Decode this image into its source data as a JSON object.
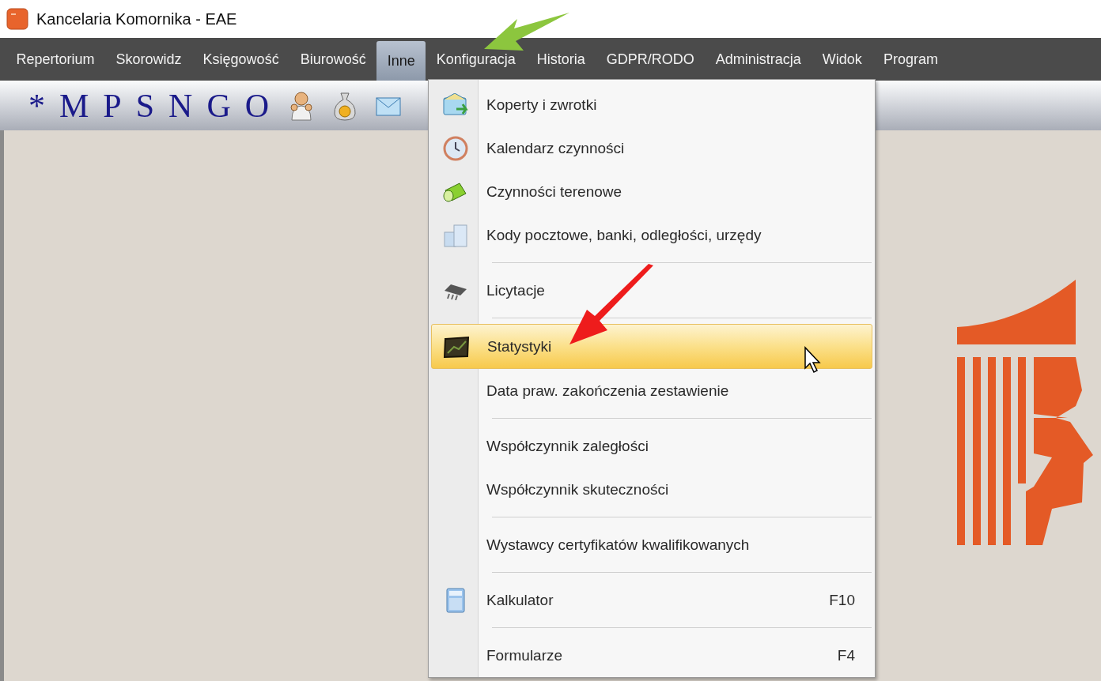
{
  "window": {
    "title": "Kancelaria Komornika - EAE"
  },
  "menubar": [
    {
      "label": "Repertorium",
      "selected": false
    },
    {
      "label": "Skorowidz",
      "selected": false
    },
    {
      "label": "Księgowość",
      "selected": false
    },
    {
      "label": "Biurowość",
      "selected": false
    },
    {
      "label": "Inne",
      "selected": true
    },
    {
      "label": "Konfiguracja",
      "selected": false
    },
    {
      "label": "Historia",
      "selected": false
    },
    {
      "label": "GDPR/RODO",
      "selected": false
    },
    {
      "label": "Administracja",
      "selected": false
    },
    {
      "label": "Widok",
      "selected": false
    },
    {
      "label": "Program",
      "selected": false
    }
  ],
  "toolbar": [
    {
      "kind": "text",
      "label": "*"
    },
    {
      "kind": "text",
      "label": "M"
    },
    {
      "kind": "text",
      "label": "P"
    },
    {
      "kind": "text",
      "label": "S"
    },
    {
      "kind": "text",
      "label": "N"
    },
    {
      "kind": "text",
      "label": "G"
    },
    {
      "kind": "text",
      "label": "O"
    },
    {
      "kind": "person"
    },
    {
      "kind": "moneybag"
    },
    {
      "kind": "envelope"
    }
  ],
  "menu": [
    {
      "kind": "envelope",
      "label": "Koperty i zwrotki",
      "separator_before": false,
      "selected": false
    },
    {
      "kind": "clock",
      "label": "Kalendarz czynności",
      "separator_before": false,
      "selected": false
    },
    {
      "kind": "flashlight",
      "label": "Czynności terenowe",
      "separator_before": false,
      "selected": false
    },
    {
      "kind": "buildings",
      "label": "Kody pocztowe, banki, odległości, urzędy",
      "separator_before": false,
      "selected": false
    },
    {
      "kind": "chip",
      "label": "Licytacje",
      "separator_before": true,
      "selected": false
    },
    {
      "kind": "chart",
      "label": "Statystyki",
      "separator_before": true,
      "selected": true
    },
    {
      "kind": "plain",
      "label": "Data praw. zakończenia zestawienie",
      "separator_before": false,
      "selected": false
    },
    {
      "kind": "plain",
      "label": "Współczynnik zaległości",
      "separator_before": true,
      "selected": false
    },
    {
      "kind": "plain",
      "label": "Współczynnik skuteczności",
      "separator_before": false,
      "selected": false
    },
    {
      "kind": "plain",
      "label": "Wystawcy certyfikatów kwalifikowanych",
      "separator_before": true,
      "selected": false
    },
    {
      "kind": "calculator",
      "label": "Kalkulator",
      "shortcut": "F10",
      "separator_before": true,
      "selected": false
    },
    {
      "kind": "plain",
      "label": "Formularze",
      "shortcut": "F4",
      "separator_before": true,
      "selected": false
    }
  ]
}
